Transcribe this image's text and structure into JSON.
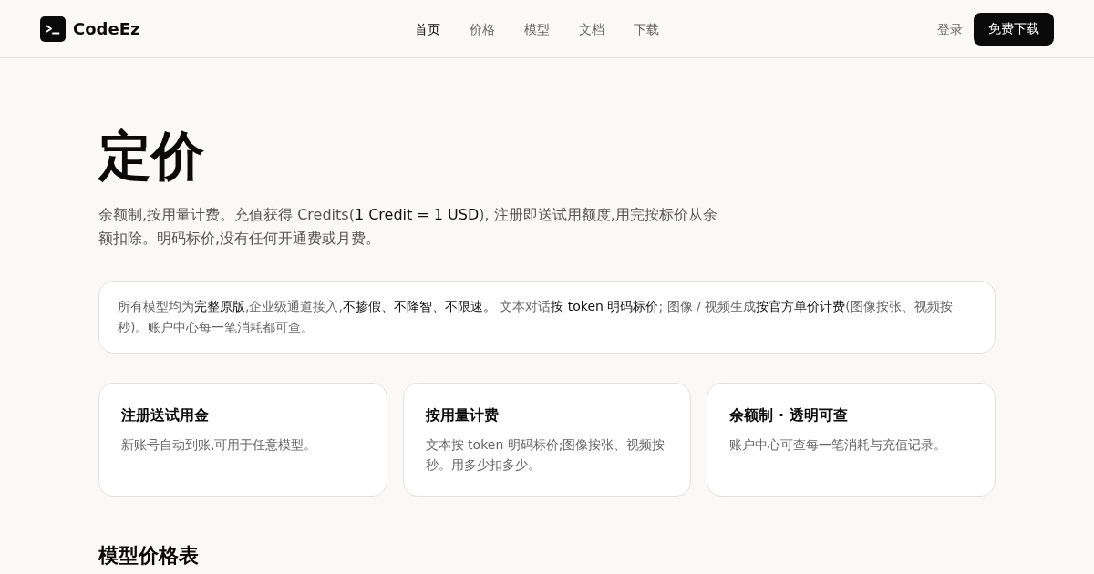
{
  "header": {
    "logo": {
      "text": "CodeEz"
    },
    "nav": [
      {
        "label": "首页",
        "selected": true
      },
      {
        "label": "价格",
        "selected": false
      },
      {
        "label": "模型",
        "selected": false
      },
      {
        "label": "文档",
        "selected": false
      },
      {
        "label": "下载",
        "selected": false
      }
    ],
    "login": "登录",
    "cta_button": "免费下载"
  },
  "page": {
    "title": "定价",
    "description": "余额制,按用量计费。充值获得 Credits(**1 Credit = 1 USD**), 注册即送试用额度,用完按标价从余额扣除。明码标价,没有任何开通费或月费。",
    "notice": "所有模型均为**完整原版**,企业级通道接入,**不掺假、不降智、不限速。** 文本对话**按 token 明码标价**; 图像 / 视频生成**按官方单价计费**(图像按张、视频按秒)。账户中心每一笔消耗都可查。",
    "features": [
      {
        "title": "注册送试用金",
        "description": "新账号自动到账,可用于任意模型。"
      },
      {
        "title": "按用量计费",
        "description": "文本按 token 明码标价;图像按张、视频按秒。用多少扣多少。"
      },
      {
        "title": "余额制 · 透明可查",
        "description": "账户中心可查每一笔消耗与充值记录。"
      }
    ],
    "section_heading": "模型价格表"
  }
}
